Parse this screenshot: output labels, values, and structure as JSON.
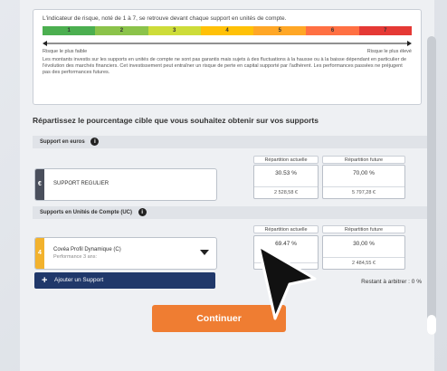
{
  "risk": {
    "intro": "L'indicateur de risque, noté de 1 à 7, se retrouve devant chaque support en unités de compte.",
    "levels": [
      "1",
      "2",
      "3",
      "4",
      "5",
      "6",
      "7"
    ],
    "colors": [
      "#4caf50",
      "#8bc34a",
      "#cddc39",
      "#ffc107",
      "#ffa726",
      "#ff7043",
      "#e53935"
    ],
    "low_label": "Risque le plus faible",
    "high_label": "Risque le plus élevé",
    "disclaimer": "Les montants investis sur les supports en unités de compte ne sont pas garantis mais sujets à des fluctuations à la hausse ou à la baisse dépendant en particulier de l'évolution des marchés financiers. Cet investissement peut entraîner un risque de perte en capital supporté par l'adhérent. Les performances passées ne préjugent pas des performances futures."
  },
  "section_title": "Répartissez le pourcentage cible que vous souhaitez obtenir sur vos supports",
  "euros": {
    "header": "Support en euros",
    "col_current": "Répartition actuelle",
    "col_future": "Répartition future",
    "support": {
      "tag": "€",
      "tag_color": "#4a4f5c",
      "label": "SUPPORT REGULIER",
      "current_pct": "30.53 %",
      "current_amount": "2 528,58 €",
      "future_pct": "70,00 %",
      "future_amount": "5 797,28 €"
    }
  },
  "uc": {
    "header": "Supports en Unités de Compte (UC)",
    "col_current": "Répartition actuelle",
    "col_future": "Répartition future",
    "support": {
      "tag": "4",
      "tag_color": "#f2b22d",
      "label": "Covéa Profil Dynamique (C)",
      "sublabel": "Performance 3 ans:",
      "current_pct": "69.47 %",
      "current_amount": "",
      "future_pct": "30,00 %",
      "future_amount": "2 484,55 €"
    }
  },
  "add_button": "Ajouter un Support",
  "remaining": "Restant à arbitrer : 0 %",
  "continue_button": "Continuer"
}
